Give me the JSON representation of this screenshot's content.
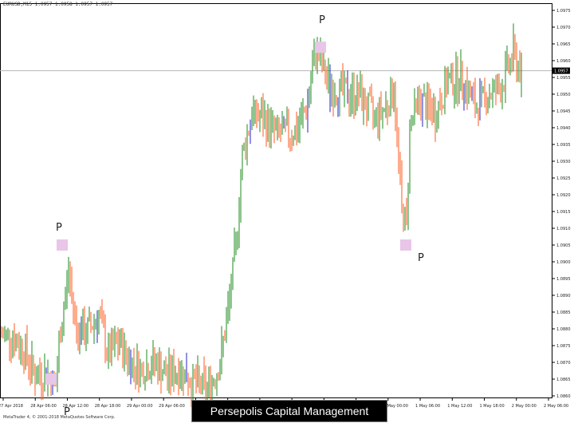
{
  "chart_data": {
    "type": "candlestick",
    "title": "",
    "xlabel": "",
    "ylabel": "",
    "grid": true,
    "up_color": "#1e8b1e",
    "down_color": "#ff5a1e",
    "alt_color": "#2323c8",
    "marker_color": "#e8c6e8",
    "x_tick_labels": [
      "27 Apr 2018",
      "28 Apr 06:00",
      "28 Apr 12:00",
      "28 Apr 18:00",
      "29 Apr 00:00",
      "29 Apr 06:00",
      "29 Apr 12:00",
      "29 Apr 18:00",
      "30 Apr 00:00",
      "30 Apr 06:00",
      "30 Apr 12:00",
      "30 Apr 18:00",
      "1 May 00:00",
      "1 May 06:00",
      "1 May 12:00",
      "1 May 18:00",
      "2 May 00:00",
      "2 May 06:00"
    ],
    "y_ticks": [
      "1.0975",
      "1.0970",
      "1.0965",
      "1.0960",
      "1.0955",
      "1.0950",
      "1.0945",
      "1.0940",
      "1.0935",
      "1.0930",
      "1.0925",
      "1.0920",
      "1.0915",
      "1.0910",
      "1.0905",
      "1.0900",
      "1.0895",
      "1.0890",
      "1.0885",
      "1.0880",
      "1.0875",
      "1.0870",
      "1.0865",
      "1.0860"
    ],
    "current_price": "1.0957",
    "pivots": [
      {
        "label": "P",
        "value": 1.0865
      },
      {
        "label": "P",
        "value": 1.0905
      },
      {
        "label": "P",
        "value": 1.0964
      },
      {
        "label": "P",
        "value": 1.0905
      }
    ],
    "close_path": [
      [
        0,
        1.0878
      ],
      [
        14,
        1.0878
      ],
      [
        30,
        1.0874
      ],
      [
        44,
        1.0866
      ],
      [
        58,
        1.0867
      ],
      [
        70,
        1.0863
      ],
      [
        76,
        1.088
      ],
      [
        86,
        1.0897
      ],
      [
        96,
        1.088
      ],
      [
        108,
        1.0879
      ],
      [
        124,
        1.0884
      ],
      [
        136,
        1.0872
      ],
      [
        150,
        1.0876
      ],
      [
        160,
        1.0871
      ],
      [
        176,
        1.0868
      ],
      [
        194,
        1.087
      ],
      [
        210,
        1.0866
      ],
      [
        226,
        1.0868
      ],
      [
        242,
        1.0864
      ],
      [
        262,
        1.0862
      ],
      [
        276,
        1.087
      ],
      [
        286,
        1.0885
      ],
      [
        296,
        1.0905
      ],
      [
        304,
        1.0932
      ],
      [
        316,
        1.0944
      ],
      [
        328,
        1.0943
      ],
      [
        348,
        1.0938
      ],
      [
        372,
        1.0939
      ],
      [
        386,
        1.0947
      ],
      [
        396,
        1.0964
      ],
      [
        404,
        1.0958
      ],
      [
        414,
        1.0952
      ],
      [
        436,
        1.095
      ],
      [
        450,
        1.095
      ],
      [
        470,
        1.0943
      ],
      [
        486,
        1.0947
      ],
      [
        494,
        1.0952
      ],
      [
        504,
        1.0915
      ],
      [
        510,
        1.0911
      ],
      [
        514,
        1.0941
      ],
      [
        526,
        1.0948
      ],
      [
        546,
        1.0944
      ],
      [
        562,
        1.0954
      ],
      [
        580,
        1.0955
      ],
      [
        596,
        1.0946
      ],
      [
        612,
        1.095
      ],
      [
        628,
        1.0952
      ],
      [
        644,
        1.0962
      ],
      [
        654,
        1.0956
      ]
    ]
  },
  "header": {
    "symbol_info": "EURUSD,M15 1.0957 1.0958 1.0957 1.0957"
  },
  "footer": {
    "copyright": "MetaTrader 4, © 2001-2018 MetaQuotes Software Corp."
  },
  "caption": {
    "text": "Persepolis Capital Management"
  }
}
